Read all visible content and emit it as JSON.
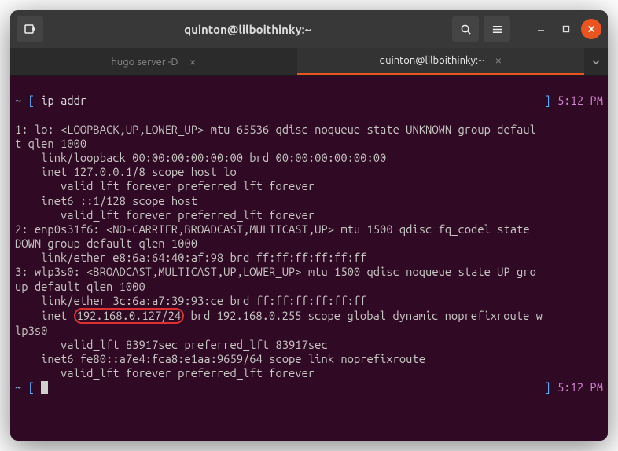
{
  "titlebar": {
    "title": "quinton@lilboithinky:~"
  },
  "tabs": [
    {
      "label": "hugo server -D",
      "active": false
    },
    {
      "label": "quinton@lilboithinky:~",
      "active": true
    }
  ],
  "prompt1": {
    "tilde": "~",
    "lbracket": "[",
    "cmd": "ip addr",
    "rbracket": "]",
    "time": "5:12 PM"
  },
  "output": {
    "l1": "1: lo: <LOOPBACK,UP,LOWER_UP> mtu 65536 qdisc noqueue state UNKNOWN group defaul",
    "l2": "t qlen 1000",
    "l3": "    link/loopback 00:00:00:00:00:00 brd 00:00:00:00:00:00",
    "l4": "    inet 127.0.0.1/8 scope host lo",
    "l5": "       valid_lft forever preferred_lft forever",
    "l6": "    inet6 ::1/128 scope host",
    "l7": "       valid_lft forever preferred_lft forever",
    "l8": "2: enp0s31f6: <NO-CARRIER,BROADCAST,MULTICAST,UP> mtu 1500 qdisc fq_codel state ",
    "l9": "DOWN group default qlen 1000",
    "l10": "    link/ether e8:6a:64:40:af:98 brd ff:ff:ff:ff:ff:ff",
    "l11": "3: wlp3s0: <BROADCAST,MULTICAST,UP,LOWER_UP> mtu 1500 qdisc noqueue state UP gro",
    "l12": "up default qlen 1000",
    "l13": "    link/ether 3c:6a:a7:39:93:ce brd ff:ff:ff:ff:ff:ff",
    "l14a": "    inet ",
    "l14_highlight": "192.168.0.127/24",
    "l14b": " brd 192.168.0.255 scope global dynamic noprefixroute w",
    "l15": "lp3s0",
    "l16": "       valid_lft 83917sec preferred_lft 83917sec",
    "l17": "    inet6 fe80::a7e4:fca8:e1aa:9659/64 scope link noprefixroute",
    "l18": "       valid_lft forever preferred_lft forever"
  },
  "prompt2": {
    "tilde": "~",
    "lbracket": "[",
    "rbracket": "]",
    "time": "5:12 PM"
  }
}
